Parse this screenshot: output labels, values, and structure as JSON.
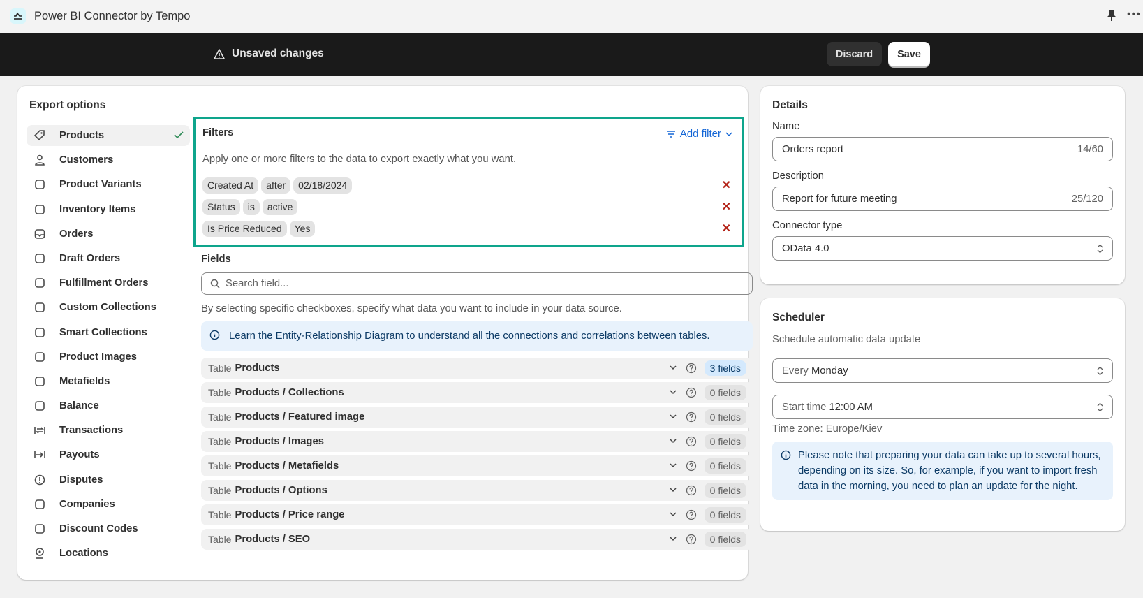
{
  "app": {
    "title": "Power BI Connector by Tempo"
  },
  "savebar": {
    "message": "Unsaved changes",
    "discard": "Discard",
    "save": "Save"
  },
  "export": {
    "title": "Export options",
    "nav": [
      {
        "label": "Products",
        "icon": "tag-icon",
        "active": true
      },
      {
        "label": "Customers",
        "icon": "person-icon"
      },
      {
        "label": "Product Variants",
        "icon": "variants-icon"
      },
      {
        "label": "Inventory Items",
        "icon": "inventory-icon"
      },
      {
        "label": "Orders",
        "icon": "inbox-icon"
      },
      {
        "label": "Draft Orders",
        "icon": "draft-icon"
      },
      {
        "label": "Fulfillment Orders",
        "icon": "fulfillment-icon"
      },
      {
        "label": "Custom Collections",
        "icon": "collection-icon"
      },
      {
        "label": "Smart Collections",
        "icon": "smart-collection-icon"
      },
      {
        "label": "Product Images",
        "icon": "image-icon"
      },
      {
        "label": "Metafields",
        "icon": "metafields-icon"
      },
      {
        "label": "Balance",
        "icon": "wallet-icon"
      },
      {
        "label": "Transactions",
        "icon": "transfer-icon"
      },
      {
        "label": "Payouts",
        "icon": "payout-icon"
      },
      {
        "label": "Disputes",
        "icon": "alert-icon"
      },
      {
        "label": "Companies",
        "icon": "briefcase-icon"
      },
      {
        "label": "Discount Codes",
        "icon": "discount-icon"
      },
      {
        "label": "Locations",
        "icon": "location-icon"
      }
    ]
  },
  "filters": {
    "title": "Filters",
    "add_filter": "Add filter",
    "description": "Apply one or more filters to the data to export exactly what you want.",
    "rows": [
      [
        "Created At",
        "after",
        "02/18/2024"
      ],
      [
        "Status",
        "is",
        "active"
      ],
      [
        "Is Price Reduced",
        "Yes"
      ]
    ]
  },
  "fields": {
    "title": "Fields",
    "search_placeholder": "Search field...",
    "description": "By selecting specific checkboxes, specify what data you want to include in your data source.",
    "banner_prefix": "Learn the ",
    "banner_link": "Entity-Relationship Diagram",
    "banner_suffix": " to understand all the connections and correlations between tables.",
    "table_prefix": "Table",
    "tables": [
      {
        "name": "Products",
        "count": "3 fields",
        "selected": true
      },
      {
        "name": "Products / Collections",
        "count": "0 fields"
      },
      {
        "name": "Products / Featured image",
        "count": "0 fields"
      },
      {
        "name": "Products / Images",
        "count": "0 fields"
      },
      {
        "name": "Products / Metafields",
        "count": "0 fields"
      },
      {
        "name": "Products / Options",
        "count": "0 fields"
      },
      {
        "name": "Products / Price range",
        "count": "0 fields"
      },
      {
        "name": "Products / SEO",
        "count": "0 fields"
      }
    ]
  },
  "details": {
    "title": "Details",
    "name_label": "Name",
    "name_value": "Orders report",
    "name_count": "14/60",
    "desc_label": "Description",
    "desc_value": "Report for future meeting",
    "desc_count": "25/120",
    "connector_label": "Connector type",
    "connector_value": "OData 4.0"
  },
  "scheduler": {
    "title": "Scheduler",
    "subtitle": "Schedule automatic data update",
    "freq_prefix": "Every",
    "freq_value": "Monday",
    "time_prefix": "Start time",
    "time_value": "12:00 AM",
    "timezone": "Time zone: Europe/Kiev",
    "note": "Please note that preparing your data can take up to several hours, depending on its size. So, for example, if you want to import fresh data in the morning, you need to plan an update for the night."
  },
  "colors": {
    "accent": "#1466d6",
    "highlight": "#0ea58c",
    "savebar": "#1a1a1a",
    "remove": "#b42318"
  }
}
